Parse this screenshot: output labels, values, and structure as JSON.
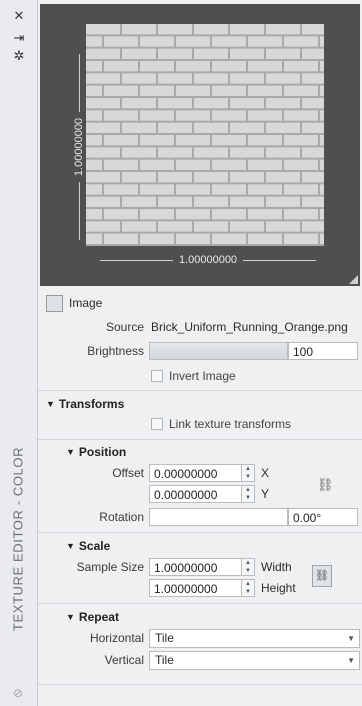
{
  "palette": {
    "sidebar": "#e9ebee",
    "panel": "#eef0f2",
    "preview_bg": "#4f4f4f",
    "brick": "#d8d8d8",
    "mortar": "#a9a9a9"
  },
  "sidebar": {
    "icons": [
      {
        "name": "close-icon",
        "glyph": "✕"
      },
      {
        "name": "pin-icon",
        "glyph": "⇥"
      },
      {
        "name": "settings-icon",
        "glyph": "✲"
      }
    ],
    "title": "TEXTURE EDITOR - COLOR",
    "bottom_icon": "texture-editor-icon"
  },
  "preview": {
    "width_label": "1.00000000",
    "height_label": "1.00000000"
  },
  "image": {
    "heading": "Image",
    "source_label": "Source",
    "source_value": "Brick_Uniform_Running_Orange.png",
    "brightness_label": "Brightness",
    "brightness_value": "100",
    "invert_label": "Invert Image"
  },
  "transforms": {
    "heading": "Transforms",
    "link_label": "Link texture transforms",
    "position": {
      "heading": "Position",
      "offset_label": "Offset",
      "offset_x": "0.00000000",
      "offset_y": "0.00000000",
      "x_axis": "X",
      "y_axis": "Y",
      "rotation_label": "Rotation",
      "rotation_value": "0.00°"
    },
    "scale": {
      "heading": "Scale",
      "sample_size_label": "Sample Size",
      "width_value": "1.00000000",
      "height_value": "1.00000000",
      "width_label": "Width",
      "height_label": "Height"
    },
    "repeat": {
      "heading": "Repeat",
      "horizontal_label": "Horizontal",
      "horizontal_value": "Tile",
      "vertical_label": "Vertical",
      "vertical_value": "Tile"
    }
  }
}
